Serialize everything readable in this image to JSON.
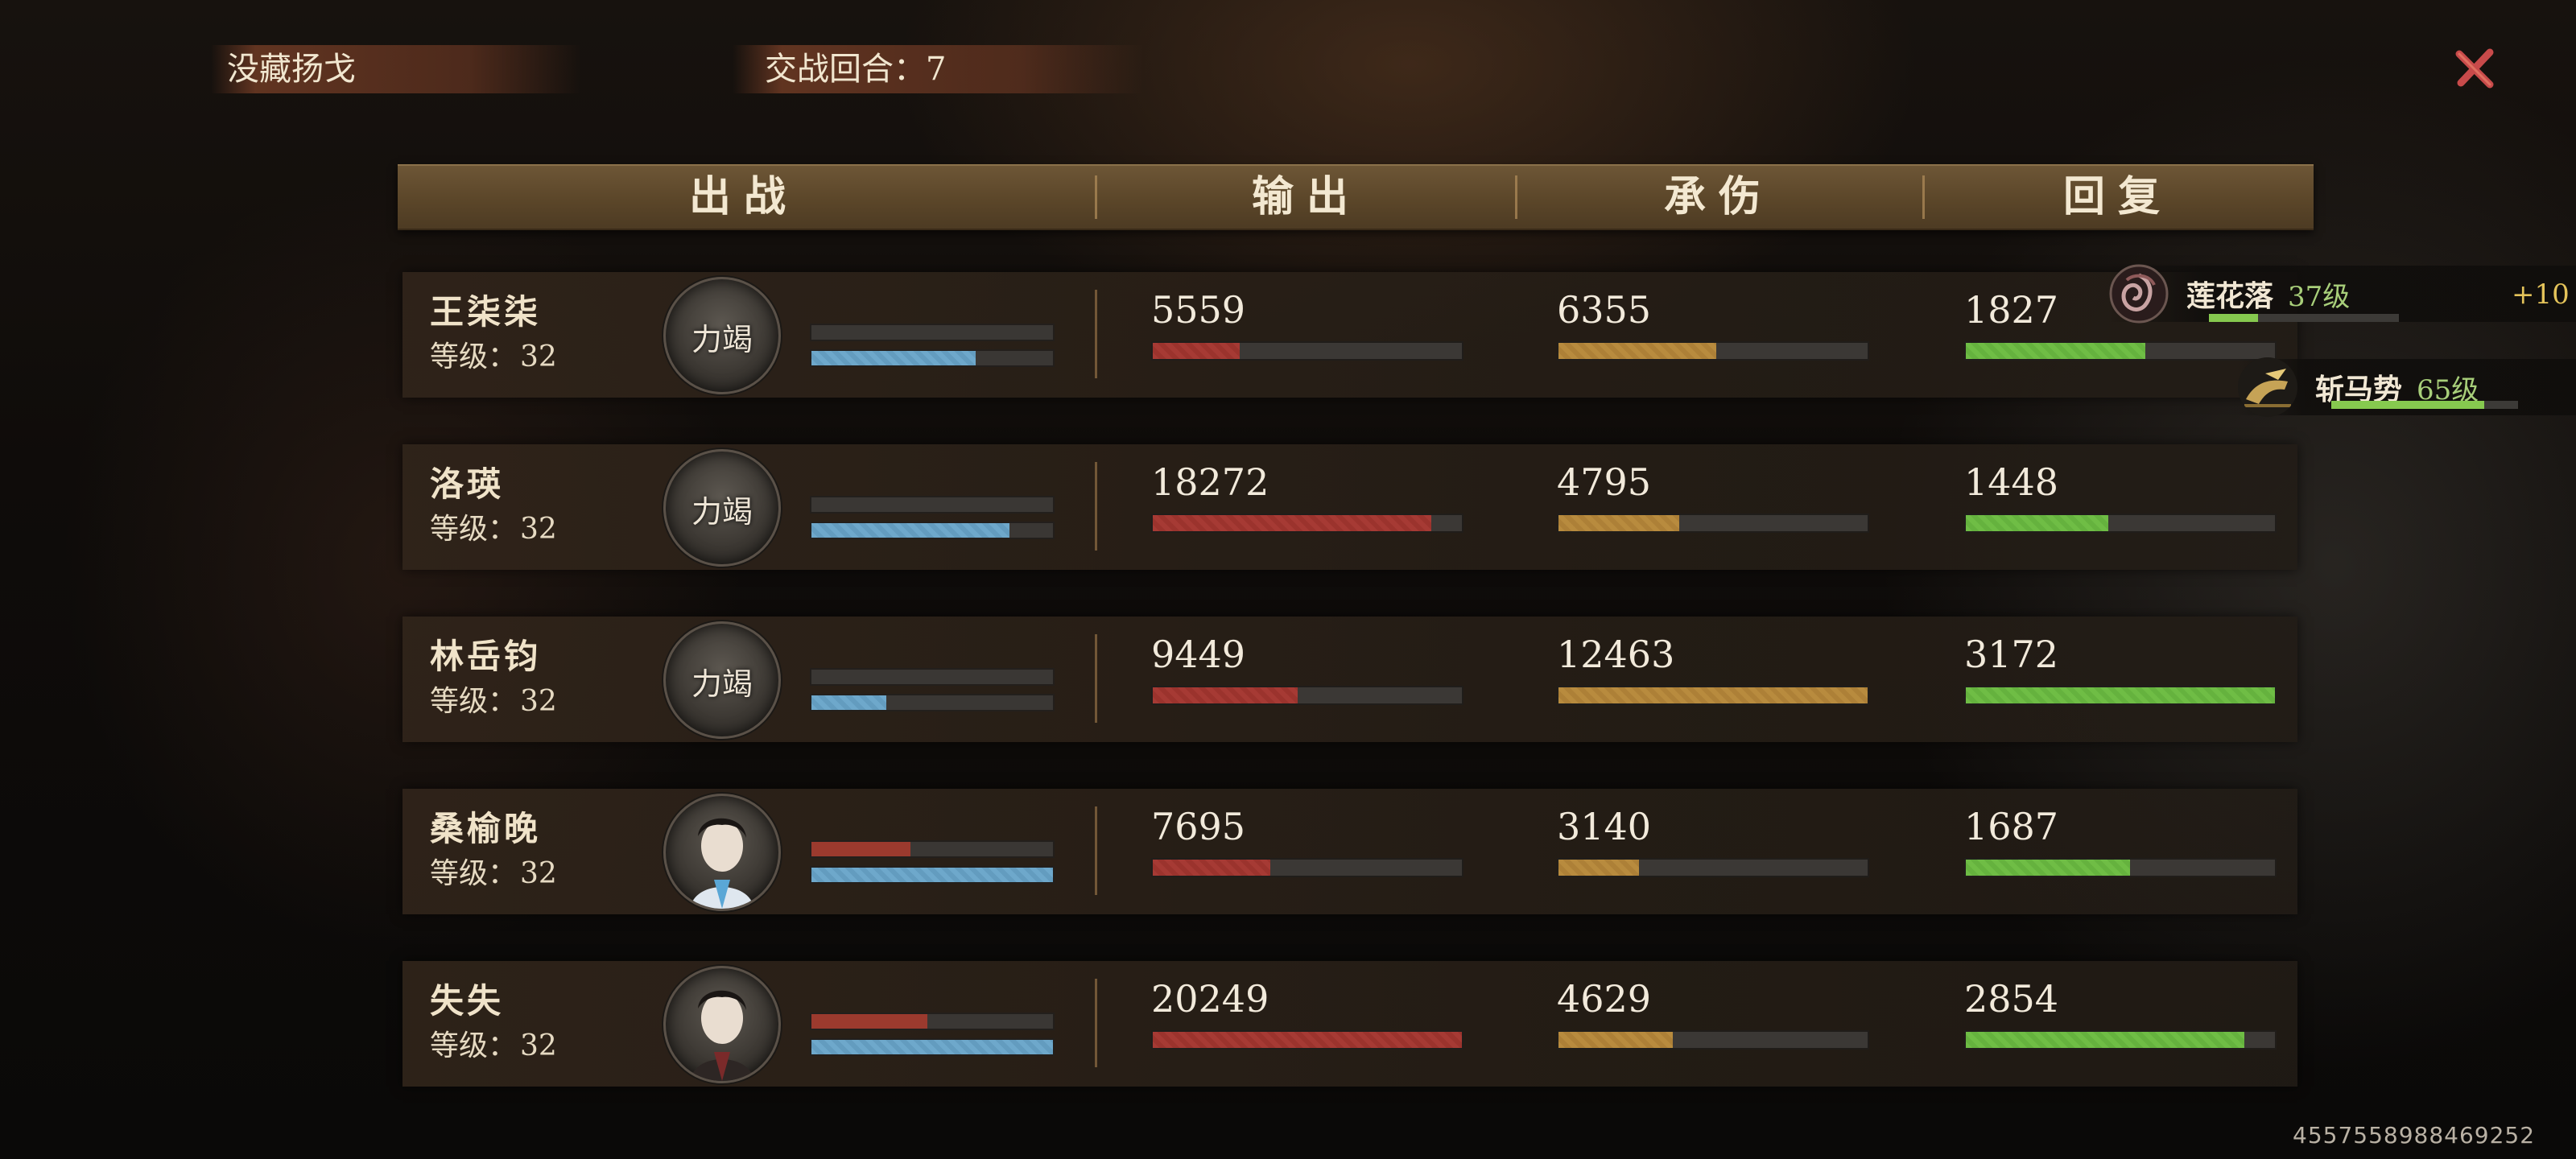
{
  "top_bar": {
    "left_tab": "没藏扬戈",
    "round_label": "交战回合：7"
  },
  "colors": {
    "output_bar": "#a63a34",
    "damage_taken_bar": "#b88b3e",
    "heal_bar": "#6fbd45",
    "hp_bar": "#6ea8cb"
  },
  "columns": {
    "battle": "出战",
    "output": "输出",
    "damage_taken": "承伤",
    "heal": "回复"
  },
  "level_label": "等级：",
  "rows": [
    {
      "name": "王柒柒",
      "level": "32",
      "avatar_label": "力竭",
      "hp_fill": 0.68,
      "red_fill": 0,
      "output": "5559",
      "output_fill": 0.28,
      "damage_taken": "6355",
      "damage_fill": 0.51,
      "heal": "1827",
      "heal_fill": 0.58
    },
    {
      "name": "洛瑛",
      "level": "32",
      "avatar_label": "力竭",
      "hp_fill": 0.82,
      "red_fill": 0,
      "output": "18272",
      "output_fill": 0.9,
      "damage_taken": "4795",
      "damage_fill": 0.39,
      "heal": "1448",
      "heal_fill": 0.46
    },
    {
      "name": "林岳钧",
      "level": "32",
      "avatar_label": "力竭",
      "hp_fill": 0.31,
      "red_fill": 0,
      "output": "9449",
      "output_fill": 0.47,
      "damage_taken": "12463",
      "damage_fill": 1.0,
      "heal": "3172",
      "heal_fill": 1.0
    },
    {
      "name": "桑榆晚",
      "level": "32",
      "avatar_label": "",
      "hp_fill": 1.0,
      "red_fill": 0.41,
      "output": "7695",
      "output_fill": 0.38,
      "damage_taken": "3140",
      "damage_fill": 0.26,
      "heal": "1687",
      "heal_fill": 0.53
    },
    {
      "name": "失失",
      "level": "32",
      "avatar_label": "",
      "hp_fill": 1.0,
      "red_fill": 0.48,
      "output": "20249",
      "output_fill": 1.0,
      "damage_taken": "4629",
      "damage_fill": 0.37,
      "heal": "2854",
      "heal_fill": 0.9
    }
  ],
  "skills": [
    {
      "name": "莲花落",
      "level": "37级",
      "fill": 0.26,
      "plus": "+10",
      "icon": "lotus-skill-icon"
    },
    {
      "name": "斩马势",
      "level": "65级",
      "fill": 0.82,
      "icon": "horse-skill-icon"
    }
  ],
  "footer_id": "4557558988469252"
}
